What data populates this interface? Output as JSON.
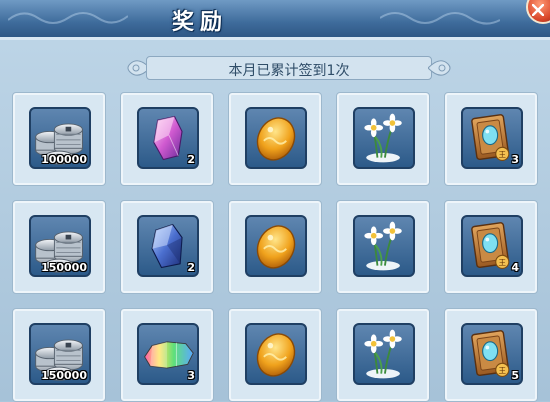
{
  "window": {
    "title": "奖励",
    "close_icon": "close-icon"
  },
  "banner": {
    "text": "本月已累计签到1次"
  },
  "colors": {
    "title_bar": "#3f6c9c",
    "panel": "#a9c7dc",
    "cell": "#d8e7f2",
    "slot": "#2c5a89",
    "close_button": "#d9472a"
  },
  "rewards": [
    [
      {
        "icon": "silver-coins-icon",
        "qty": "100000"
      },
      {
        "icon": "pink-crystal-icon",
        "qty": "2"
      },
      {
        "icon": "golden-egg-icon",
        "qty": ""
      },
      {
        "icon": "narcissus-flower-icon",
        "qty": ""
      },
      {
        "icon": "blue-gem-card-icon",
        "qty": "3"
      }
    ],
    [
      {
        "icon": "silver-coins-icon",
        "qty": "150000"
      },
      {
        "icon": "blue-crystal-icon",
        "qty": "2"
      },
      {
        "icon": "golden-egg-icon",
        "qty": ""
      },
      {
        "icon": "narcissus-flower-icon",
        "qty": ""
      },
      {
        "icon": "blue-gem-card-icon",
        "qty": "4"
      }
    ],
    [
      {
        "icon": "silver-coins-icon",
        "qty": "150000"
      },
      {
        "icon": "rainbow-crystal-icon",
        "qty": "3"
      },
      {
        "icon": "golden-egg-icon",
        "qty": ""
      },
      {
        "icon": "narcissus-flower-icon",
        "qty": ""
      },
      {
        "icon": "blue-gem-card-icon",
        "qty": "5"
      }
    ]
  ]
}
